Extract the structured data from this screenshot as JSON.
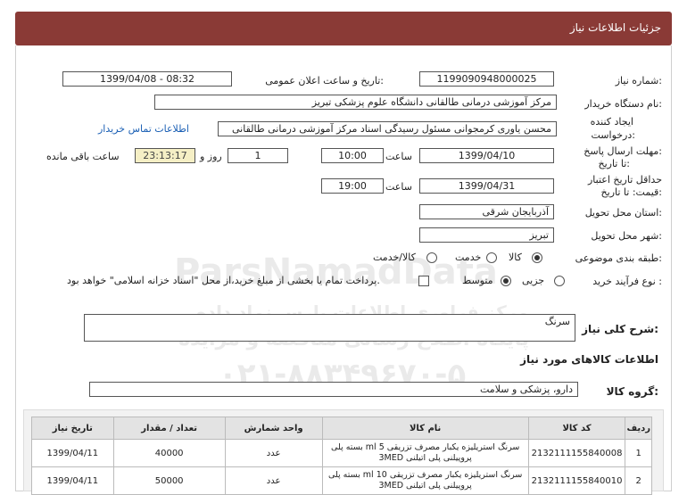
{
  "header": {
    "title": "جزئیات اطلاعات نیاز"
  },
  "form": {
    "need_number_label": "شماره نیاز:",
    "need_number": "1199090948000025",
    "announce_label": "تاریخ و ساعت اعلان عمومی:",
    "announce_value": "1399/04/08 - 08:32",
    "buyer_label": "نام دستگاه خریدار:",
    "buyer_value": "مرکز آموزشی درمانی طالقانی دانشگاه علوم پزشکی تبریز",
    "creator_label_1": "ایجاد کننده",
    "creator_label_2": "درخواست:",
    "creator_value": "محسن یاوری کرمجوانی مسئول رسیدگی اسناد مرکز آموزشی درمانی طالقانی",
    "contact_link": "اطلاعات تماس خریدار",
    "deadline_label_1": "مهلت ارسال پاسخ:",
    "deadline_label_2": "تا تاریخ:",
    "deadline_date": "1399/04/10",
    "time_label": "ساعت",
    "deadline_time": "10:00",
    "days_value": "1",
    "days_label": "روز و",
    "remaining_time": "23:13:17",
    "remaining_label": "ساعت باقی مانده",
    "validity_label_1": "حداقل تاریخ اعتبار",
    "validity_label_2": "قیمت: تا تاریخ:",
    "validity_date": "1399/04/31",
    "validity_time_label": "ساعت",
    "validity_time": "19:00",
    "province_label": "استان محل تحویل:",
    "province_value": "آذربایجان شرقی",
    "city_label": "شهر محل تحویل:",
    "city_value": "تبریز",
    "category_label": "طبقه بندی موضوعی:",
    "category_options": [
      "کالا",
      "خدمت",
      "کالا/خدمت"
    ],
    "process_label": "نوع فرآیند خرید :",
    "process_options": [
      "جزیی",
      "متوسط"
    ],
    "payment_note": "پرداخت تمام یا بخشی از مبلغ خرید،از محل \"اسناد خزانه اسلامی\" خواهد بود."
  },
  "summary": {
    "label": "شرح کلی نیاز:",
    "value": "سرنگ"
  },
  "goods_section": {
    "title": "اطلاعات کالاهای مورد نیاز",
    "group_label": "گروه کالا:",
    "group_value": "دارو، پزشکی و سلامت"
  },
  "watermark": {
    "line1": "ParsNamadData",
    "line2": "مرکز فراوری اطلاعات پارس نماد داده",
    "line3": "پایگاه اطلاع رسانی مناقصه و مزایده",
    "line4": "۰۲۱-۸۸۳۴۹۶۷۰-۵"
  },
  "table": {
    "headers": [
      "ردیف",
      "کد کالا",
      "نام کالا",
      "واحد شمارش",
      "تعداد / مقدار",
      "تاریخ نیاز"
    ],
    "rows": [
      [
        "1",
        "2132111155840008",
        "سرنگ استریلیزه یکبار مصرف تزریقی 5 ml بسته پلی پروپیلنی پلی اتیلنی 3MED",
        "عدد",
        "40000",
        "1399/04/11"
      ],
      [
        "2",
        "2132111155840010",
        "سرنگ استریلیزه یکبار مصرف تزریقی 10 ml بسته پلی پروپیلنی پلی اتیلنی 3MED",
        "عدد",
        "50000",
        "1399/04/11"
      ]
    ]
  }
}
